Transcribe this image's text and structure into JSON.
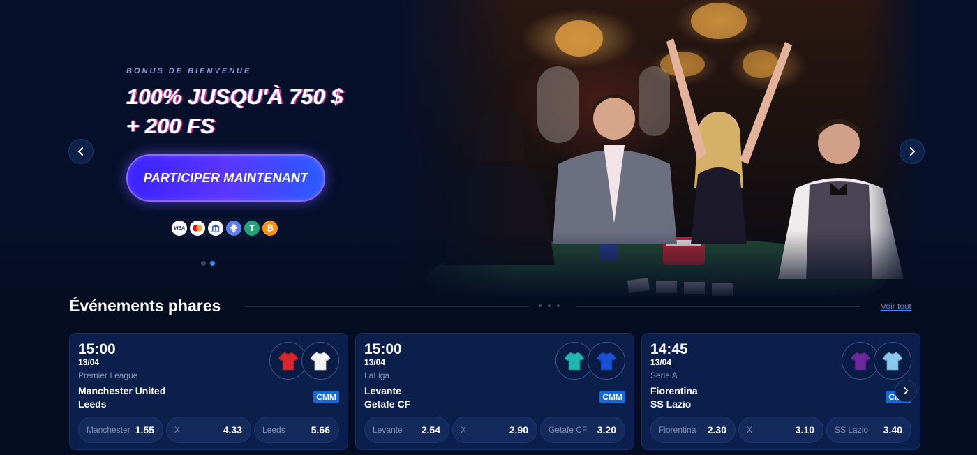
{
  "hero": {
    "kicker": "BONUS DE BIENVENUE",
    "title_line1": "100% JUSQU'À 750 $",
    "title_line2": "+ 200 FS",
    "cta_label": "PARTICIPER MAINTENANT",
    "payment_methods": [
      {
        "name": "visa",
        "label": "VISA",
        "color": "#ffffff"
      },
      {
        "name": "mastercard",
        "label": "",
        "color": "#ffffff"
      },
      {
        "name": "bank",
        "label": "",
        "color": "#ffffff"
      },
      {
        "name": "ethereum",
        "label": "Ξ",
        "color": "#627eea"
      },
      {
        "name": "tether",
        "label": "T",
        "color": "#26a17b"
      },
      {
        "name": "bitcoin",
        "label": "₿",
        "color": "#f7931a"
      }
    ],
    "slides_total": 2,
    "active_slide": 2
  },
  "events": {
    "title": "Événements phares",
    "see_all": "Voir tout",
    "cards": [
      {
        "time": "15:00",
        "date": "13/04",
        "league": "Premier League",
        "home": "Manchester United",
        "away": "Leeds",
        "market": "CMM",
        "home_kit": "#d9262c",
        "away_kit": "#f2f2f2",
        "odds": [
          {
            "label": "Manchester United",
            "value": "1.55"
          },
          {
            "label": "X",
            "value": "4.33"
          },
          {
            "label": "Leeds",
            "value": "5.66"
          }
        ]
      },
      {
        "time": "15:00",
        "date": "13/04",
        "league": "LaLiga",
        "home": "Levante",
        "away": "Getafe CF",
        "market": "CMM",
        "home_kit": "#21b6b0",
        "away_kit": "#1d4fd6",
        "odds": [
          {
            "label": "Levante",
            "value": "2.54"
          },
          {
            "label": "X",
            "value": "2.90"
          },
          {
            "label": "Getafe CF",
            "value": "3.20"
          }
        ]
      },
      {
        "time": "14:45",
        "date": "13/04",
        "league": "Serie A",
        "home": "Fiorentina",
        "away": "SS Lazio",
        "market": "CMM",
        "home_kit": "#6b2a9c",
        "away_kit": "#8cc8ee",
        "odds": [
          {
            "label": "Fiorentina",
            "value": "2.30"
          },
          {
            "label": "X",
            "value": "3.10"
          },
          {
            "label": "SS Lazio",
            "value": "3.40"
          }
        ]
      }
    ]
  },
  "colors": {
    "background": "#050d22",
    "card": "#0b1f4d",
    "accent": "#2a8cff",
    "cta": "#4b2cff",
    "market_badge": "#1769d8"
  }
}
